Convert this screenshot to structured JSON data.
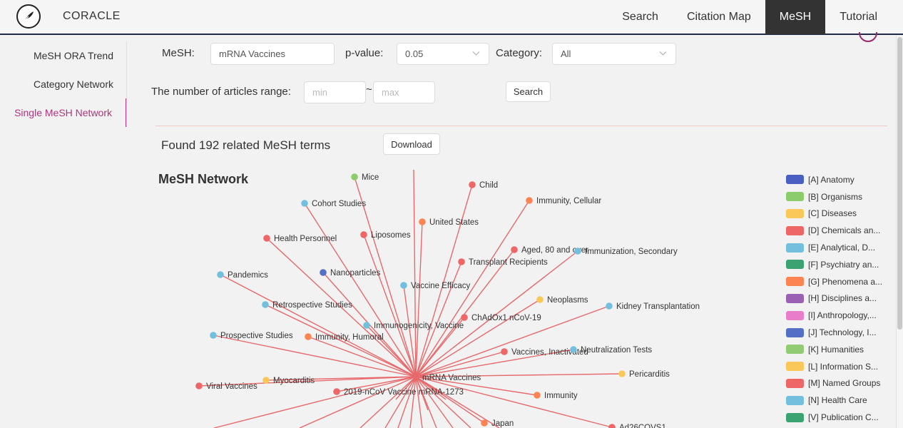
{
  "app": {
    "brand": "CORACLE"
  },
  "nav": [
    {
      "label": "Search",
      "active": false
    },
    {
      "label": "Citation Map",
      "active": false
    },
    {
      "label": "MeSH",
      "active": true
    },
    {
      "label": "Tutorial",
      "active": false
    }
  ],
  "sidebar": [
    {
      "label": "MeSH ORA Trend",
      "active": false
    },
    {
      "label": "Category Network",
      "active": false
    },
    {
      "label": "Single MeSH Network",
      "active": true
    }
  ],
  "form": {
    "mesh_label": "MeSH:",
    "mesh_value": "mRNA Vaccines",
    "pvalue_label": "p-value:",
    "pvalue_value": "0.05",
    "category_label": "Category:",
    "category_value": "All",
    "range_label": "The number of articles range:",
    "min_placeholder": "min",
    "max_placeholder": "max",
    "range_sep": "~",
    "search_button": "Search"
  },
  "result": {
    "found_text": "Found 192 related MeSH terms",
    "download_button": "Download"
  },
  "network": {
    "title": "MeSH Network",
    "center": "mRNA Vaccines",
    "link_color": "#e8696b",
    "nodes": [
      {
        "label": "Mice",
        "cat": "B"
      },
      {
        "label": "Child",
        "cat": "M"
      },
      {
        "label": "Immunity, Cellular",
        "cat": "G"
      },
      {
        "label": "Cohort Studies",
        "cat": "E"
      },
      {
        "label": "United States",
        "cat": "G"
      },
      {
        "label": "Liposomes",
        "cat": "D"
      },
      {
        "label": "Health Personnel",
        "cat": "M"
      },
      {
        "label": "Aged, 80 and over",
        "cat": "M"
      },
      {
        "label": "Immunization, Secondary",
        "cat": "E"
      },
      {
        "label": "Transplant Recipients",
        "cat": "M"
      },
      {
        "label": "Pandemics",
        "cat": "N"
      },
      {
        "label": "Nanoparticles",
        "cat": "J"
      },
      {
        "label": "Vaccine Efficacy",
        "cat": "E"
      },
      {
        "label": "Neoplasms",
        "cat": "C"
      },
      {
        "label": "Kidney Transplantation",
        "cat": "E"
      },
      {
        "label": "Retrospective Studies",
        "cat": "E"
      },
      {
        "label": "ChAdOx1 nCoV-19",
        "cat": "D"
      },
      {
        "label": "Immunogenicity, Vaccine",
        "cat": "E"
      },
      {
        "label": "Prospective Studies",
        "cat": "E"
      },
      {
        "label": "Immunity, Humoral",
        "cat": "G"
      },
      {
        "label": "Vaccines, Inactivated",
        "cat": "D"
      },
      {
        "label": "Neutralization Tests",
        "cat": "E"
      },
      {
        "label": "Pericarditis",
        "cat": "C"
      },
      {
        "label": "Myocarditis",
        "cat": "C"
      },
      {
        "label": "Viral Vaccines",
        "cat": "D"
      },
      {
        "label": "2019-nCoV Vaccine mRNA-1273",
        "cat": "D"
      },
      {
        "label": "Immunity",
        "cat": "G"
      },
      {
        "label": "Japan",
        "cat": "G"
      },
      {
        "label": "Ad26COVS1",
        "cat": "D"
      }
    ]
  },
  "legend": [
    {
      "code": "A",
      "label": "[A] Anatomy",
      "color": "#4a5fc1"
    },
    {
      "code": "B",
      "label": "[B] Organisms",
      "color": "#8ccc6a"
    },
    {
      "code": "C",
      "label": "[C] Diseases",
      "color": "#fac858"
    },
    {
      "code": "D",
      "label": "[D] Chemicals an...",
      "color": "#ee6666"
    },
    {
      "code": "E",
      "label": "[E] Analytical, D...",
      "color": "#73c0de"
    },
    {
      "code": "F",
      "label": "[F] Psychiatry an...",
      "color": "#3ba272"
    },
    {
      "code": "G",
      "label": "[G] Phenomena a...",
      "color": "#fc8452"
    },
    {
      "code": "H",
      "label": "[H] Disciplines a...",
      "color": "#9a60b4"
    },
    {
      "code": "I",
      "label": "[I] Anthropology,...",
      "color": "#ea7ccc"
    },
    {
      "code": "J",
      "label": "[J] Technology, I...",
      "color": "#5470c6"
    },
    {
      "code": "K",
      "label": "[K] Humanities",
      "color": "#91cc75"
    },
    {
      "code": "L",
      "label": "[L] Information S...",
      "color": "#fac858"
    },
    {
      "code": "M",
      "label": "[M] Named Groups",
      "color": "#ee6666"
    },
    {
      "code": "N",
      "label": "[N] Health Care",
      "color": "#73c0de"
    },
    {
      "code": "V",
      "label": "[V] Publication C...",
      "color": "#3ba272"
    }
  ]
}
